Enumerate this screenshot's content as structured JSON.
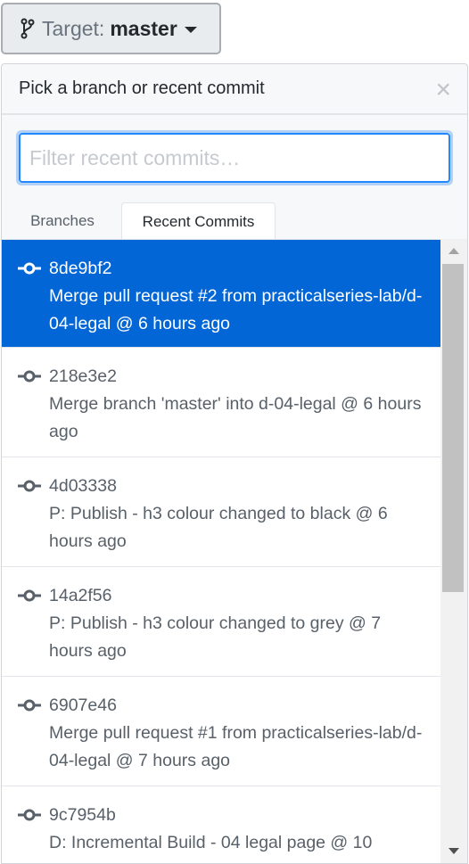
{
  "target": {
    "label": "Target:",
    "value": "master"
  },
  "panel": {
    "title": "Pick a branch or recent commit",
    "close": "×"
  },
  "filter": {
    "placeholder": "Filter recent commits…",
    "value": ""
  },
  "tabs": [
    {
      "label": "Branches"
    },
    {
      "label": "Recent Commits",
      "active": true
    }
  ],
  "commits": [
    {
      "sha": "8de9bf2",
      "message": "Merge pull request #2 from practicalseries-lab/d-04-legal @ 6 hours ago",
      "selected": true
    },
    {
      "sha": "218e3e2",
      "message": "Merge branch 'master' into d-04-legal @ 6 hours ago"
    },
    {
      "sha": "4d03338",
      "message": "P: Publish - h3 colour changed to black @ 6 hours ago"
    },
    {
      "sha": "14a2f56",
      "message": "P: Publish - h3 colour changed to grey @ 7 hours ago"
    },
    {
      "sha": "6907e46",
      "message": "Merge pull request #1 from practicalseries-lab/d-04-legal @ 7 hours ago"
    },
    {
      "sha": "9c7954b",
      "message": "D: Incremental Build - 04 legal page @ 10"
    }
  ],
  "colors": {
    "selected": "#0366d6",
    "focus": "#2188ff"
  }
}
